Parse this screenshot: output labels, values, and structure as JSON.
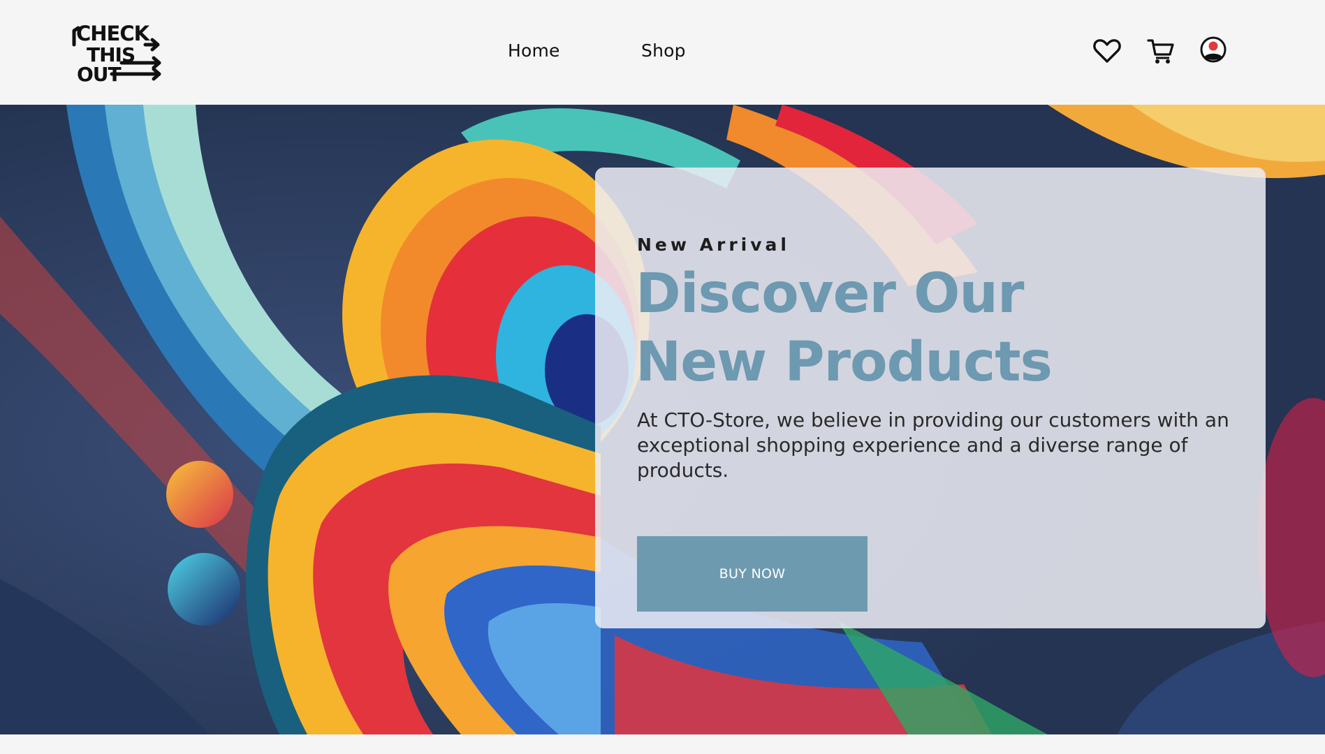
{
  "header": {
    "logo_lines": [
      "CHECK",
      "THIS",
      "OUT"
    ],
    "nav": [
      {
        "label": "Home"
      },
      {
        "label": "Shop"
      }
    ],
    "icons": [
      "heart-icon",
      "cart-icon",
      "user-icon"
    ]
  },
  "hero": {
    "eyebrow": "New Arrival",
    "headline_line1": "Discover Our",
    "headline_line2": "New Products",
    "description": "At CTO-Store, we believe in providing our customers with an exceptional shopping experience and a diverse range of products.",
    "button_label": "BUY NOW"
  },
  "colors": {
    "accent": "#6e9ab0",
    "header_bg": "#f5f5f5",
    "hero_bg": "#2c3e61"
  }
}
